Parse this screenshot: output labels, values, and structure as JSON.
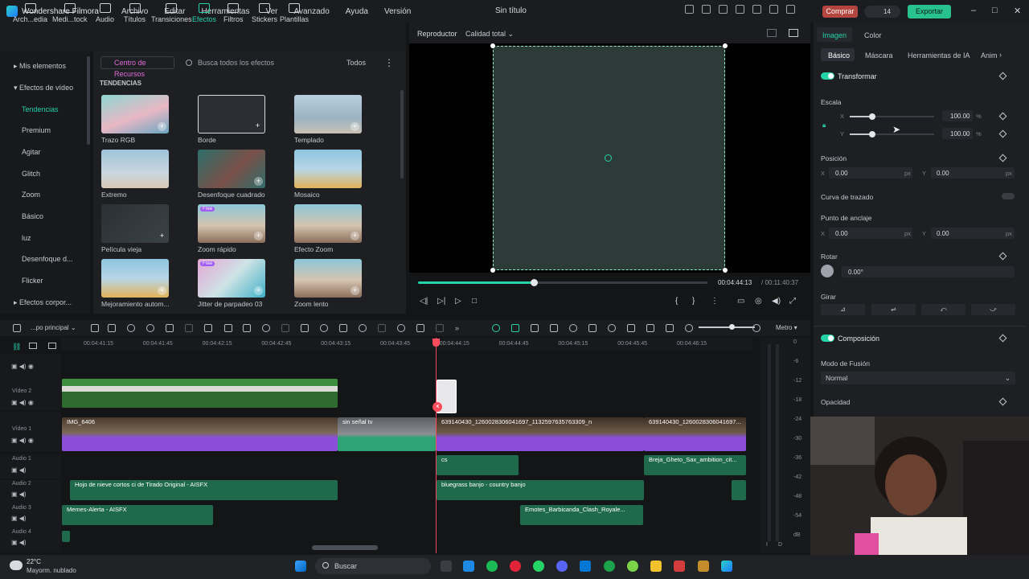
{
  "app": {
    "name": "Wondershare Filmora",
    "menu": [
      "Archivo",
      "Editar",
      "Herramientas",
      "Ver",
      "Avanzado",
      "Ayuda",
      "Versión"
    ],
    "title": "Sin título",
    "buy_label": "Comprar",
    "credits": "14",
    "export_label": "Exportar"
  },
  "toolbar": {
    "items": [
      "Arch...edia",
      "Medi...tock",
      "Audio",
      "Títulos",
      "Transiciones",
      "Efectos",
      "Filtros",
      "Stickers",
      "Plantillas"
    ],
    "active": "Efectos"
  },
  "sidebar": {
    "my_elements": "Mis elementos",
    "video_effects": "Efectos de vídeo",
    "items": [
      "Tendencias",
      "Premium",
      "Agitar",
      "Glitch",
      "Zoom",
      "Básico",
      "luz",
      "Desenfoque d...",
      "Flicker"
    ],
    "corporate": "Efectos corpor...",
    "active": "Tendencias"
  },
  "effects": {
    "resource_center": "Centro de Recursos",
    "search_placeholder": "Busca todos los efectos",
    "filter": "Todos",
    "section": "TENDENCIAS",
    "items": [
      {
        "name": "Trazo RGB",
        "free": false
      },
      {
        "name": "Borde",
        "free": false
      },
      {
        "name": "Templado",
        "free": false
      },
      {
        "name": "Extremo",
        "free": false
      },
      {
        "name": "Desenfoque cuadrado",
        "free": false
      },
      {
        "name": "Mosaico",
        "free": false
      },
      {
        "name": "Película vieja",
        "free": false
      },
      {
        "name": "Zoom rápido",
        "free": true
      },
      {
        "name": "Efecto Zoom",
        "free": false
      },
      {
        "name": "Mejoramiento autom...",
        "free": false
      },
      {
        "name": "Jitter de parpadeo 03",
        "free": true
      },
      {
        "name": "Zoom lento",
        "free": false
      }
    ],
    "free_label": "Free"
  },
  "player": {
    "label": "Reproductor",
    "quality": "Calidad total",
    "current_time": "00:04:44:13",
    "total_time": "/ 00:11:40:37",
    "progress": 0.4
  },
  "inspector": {
    "tabs": [
      "Imagen",
      "Color"
    ],
    "subtabs": [
      "Básico",
      "Máscara",
      "Herramientas de IA",
      "Anim"
    ],
    "transform": "Transformar",
    "scale": "Escala",
    "scale_x": "100.00",
    "scale_y": "100.00",
    "percent": "%",
    "position": "Posición",
    "pos_x": "0.00",
    "pos_y": "0.00",
    "px": "px",
    "path_curve": "Curva de trazado",
    "anchor": "Punto de anclaje",
    "anchor_x": "0.00",
    "anchor_y": "0.00",
    "rotate": "Rotar",
    "rotate_val": "0.00°",
    "flip": "Girar",
    "composition": "Composición",
    "blend_mode": "Modo de Fusión",
    "blend_value": "Normal",
    "opacity": "Opacidad",
    "x": "X",
    "y": "Y"
  },
  "timeline": {
    "sequence": "...po principal",
    "meter": "Metro",
    "ticks": [
      "00:04:41:15",
      "00:04:41:45",
      "00:04:42:15",
      "00:04:42:45",
      "00:04:43:15",
      "00:04:43:45",
      "00:04:44:15",
      "00:04:44:45",
      "00:04:45:15",
      "00:04:45:45",
      "00:04:46:15"
    ],
    "tracks": [
      "Vídeo 2",
      "Vídeo 1",
      "Audio 1",
      "Audio 2",
      "Audio 3",
      "Audio 4"
    ],
    "clips": {
      "v1a": "IMG_6406",
      "v1b": "sin señal tv",
      "v1c": "639140430_1260028306041697_1132597635763309_n",
      "v1d": "639140430_1260028306041697...",
      "a1a": "cs",
      "a1b": "Breja_Gheto_Sax_ambition_cit...",
      "a2a": "Hojo de nieve cortos ci de Tirado Original - AISFX",
      "a2b": "bluegrass banjo - country banjo",
      "a3a": "Memes-Alerta - AISFX",
      "a3b": "Emotes_Barbicanda_Clash_Royale..."
    },
    "vu_labels": [
      "0",
      "-6",
      "-12",
      "-18",
      "-24",
      "-30",
      "-36",
      "-42",
      "-48",
      "-54",
      "dB"
    ],
    "lr": [
      "I",
      "D"
    ]
  },
  "taskbar": {
    "temp": "22°C",
    "weather": "Mayorm. nublado",
    "search": "Buscar"
  }
}
